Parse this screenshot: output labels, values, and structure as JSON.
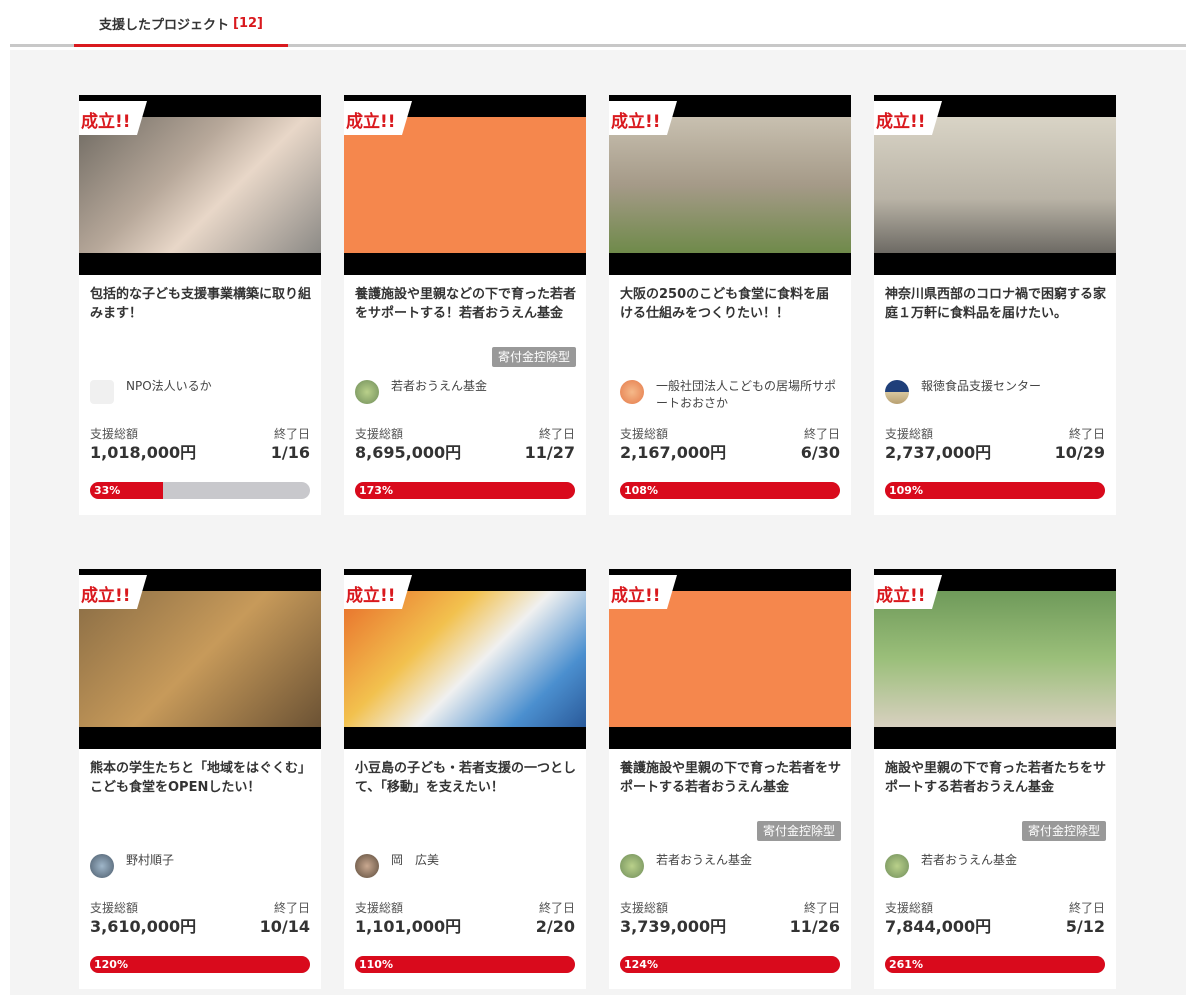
{
  "tab": {
    "label": "支援したプロジェクト",
    "count": "[12]"
  },
  "badge_label": "成立!!",
  "stat_labels": {
    "total": "支援総額",
    "end": "終了日"
  },
  "colors": {
    "accent": "#d9191e",
    "bar_track": "#c8c8cc",
    "tax_badge": "#999999"
  },
  "cards": [
    {
      "title": "包括的な子ども支援事業構築に取り組みます！",
      "tax": "",
      "org": "NPO法人いるか",
      "total": "1,018,000円",
      "end": "1/16",
      "percent": "33%",
      "progress": 33
    },
    {
      "title": "養護施設や里親などの下で育った若者をサポートする！若者おうえん基金",
      "tax": "寄付金控除型",
      "org": "若者おうえん基金",
      "total": "8,695,000円",
      "end": "11/27",
      "percent": "173%",
      "progress": 100
    },
    {
      "title": "大阪の250のこども食堂に食料を届ける仕組みをつくりたい！！",
      "tax": "",
      "org": "一般社団法人こどもの居場所サポートおおさか",
      "total": "2,167,000円",
      "end": "6/30",
      "percent": "108%",
      "progress": 100
    },
    {
      "title": "神奈川県西部のコロナ禍で困窮する家庭１万軒に食料品を届けたい。",
      "tax": "",
      "org": "報徳食品支援センター",
      "total": "2,737,000円",
      "end": "10/29",
      "percent": "109%",
      "progress": 100
    },
    {
      "title": "熊本の学生たちと「地域をはぐくむ」こども食堂をOPENしたい！",
      "tax": "",
      "org": "野村順子",
      "total": "3,610,000円",
      "end": "10/14",
      "percent": "120%",
      "progress": 100
    },
    {
      "title": "小豆島の子ども・若者支援の一つとして、「移動」を支えたい！",
      "tax": "",
      "org": "岡　広美",
      "total": "1,101,000円",
      "end": "2/20",
      "percent": "110%",
      "progress": 100
    },
    {
      "title": "養護施設や里親の下で育った若者をサポートする若者おうえん基金",
      "tax": "寄付金控除型",
      "org": "若者おうえん基金",
      "total": "3,739,000円",
      "end": "11/26",
      "percent": "124%",
      "progress": 100
    },
    {
      "title": "施設や里親の下で育った若者たちをサポートする若者おうえん基金",
      "tax": "寄付金控除型",
      "org": "若者おうえん基金",
      "total": "7,844,000円",
      "end": "5/12",
      "percent": "261%",
      "progress": 100
    }
  ]
}
